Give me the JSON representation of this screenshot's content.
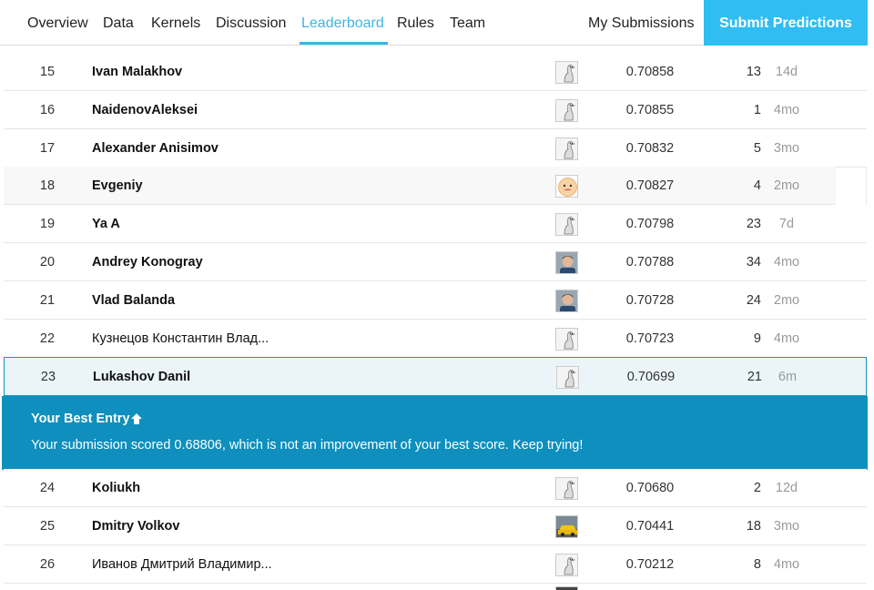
{
  "nav": {
    "tabs": [
      {
        "label": "Overview"
      },
      {
        "label": "Data"
      },
      {
        "label": "Kernels"
      },
      {
        "label": "Discussion"
      },
      {
        "label": "Leaderboard"
      },
      {
        "label": "Rules"
      },
      {
        "label": "Team"
      }
    ],
    "active_tab": "Leaderboard",
    "my_submissions": "My Submissions",
    "submit": "Submit Predictions"
  },
  "rows_top": [
    {
      "rank": "15",
      "team": "Ivan Malakhov",
      "score": "0.70858",
      "entries": "13",
      "last": "14d",
      "avatar": "goose-icon",
      "tier": "novice"
    },
    {
      "rank": "16",
      "team": "NaidenovAleksei",
      "score": "0.70855",
      "entries": "1",
      "last": "4mo",
      "avatar": "goose-icon",
      "tier": "expert"
    },
    {
      "rank": "17",
      "team": "Alexander Anisimov",
      "score": "0.70832",
      "entries": "5",
      "last": "3mo",
      "avatar": "goose-icon",
      "tier": ""
    },
    {
      "rank": "18",
      "team": "Evgeniy",
      "score": "0.70827",
      "entries": "4",
      "last": "2mo",
      "avatar": "cartoon-face-icon",
      "tier": ""
    },
    {
      "rank": "19",
      "team": "Ya A",
      "score": "0.70798",
      "entries": "23",
      "last": "7d",
      "avatar": "goose-icon",
      "tier": "novice"
    },
    {
      "rank": "20",
      "team": "Andrey Konogray",
      "score": "0.70788",
      "entries": "34",
      "last": "4mo",
      "avatar": "person-photo-icon",
      "tier": ""
    },
    {
      "rank": "21",
      "team": "Vlad Balanda",
      "score": "0.70728",
      "entries": "24",
      "last": "2mo",
      "avatar": "person-photo-icon",
      "tier": "expert"
    },
    {
      "rank": "22",
      "team": "Кузнецов Константин Влад...",
      "score": "0.70723",
      "entries": "9",
      "last": "4mo",
      "avatar": "goose-icon",
      "tier": "novice"
    }
  ],
  "my_row": {
    "rank": "23",
    "team": "Lukashov Danil",
    "score": "0.70699",
    "entries": "21",
    "last": "6m",
    "avatar": "goose-icon",
    "tier": "novice"
  },
  "banner": {
    "title": "Your Best Entry",
    "message": "Your submission scored 0.68806, which is not an improvement of your best score. Keep trying!"
  },
  "rows_bottom": [
    {
      "rank": "24",
      "team": "Koliukh",
      "score": "0.70680",
      "entries": "2",
      "last": "12d",
      "avatar": "goose-icon",
      "tier": "novice"
    },
    {
      "rank": "25",
      "team": "Dmitry Volkov",
      "score": "0.70441",
      "entries": "18",
      "last": "3mo",
      "avatar": "car-photo-icon",
      "tier": "novice"
    },
    {
      "rank": "26",
      "team": "Иванов Дмитрий Владимир...",
      "score": "0.70212",
      "entries": "8",
      "last": "4mo",
      "avatar": "goose-icon",
      "tier": "novice"
    }
  ],
  "colors": {
    "accent": "#3cb4e6",
    "submit_bg": "#2fbdf2",
    "banner_bg": "#0e8fbd",
    "my_row_bg": "#ebf5f9",
    "my_row_border": "#1893bc",
    "novice_tier": "#5ac995",
    "expert_tier": "#95628f",
    "contributor_tier": "#20beff"
  }
}
